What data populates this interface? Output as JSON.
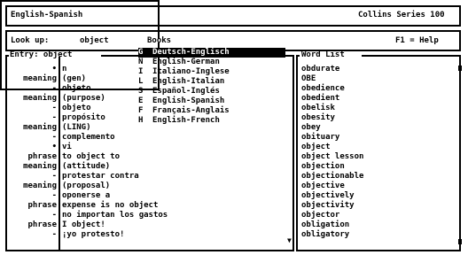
{
  "title": {
    "left": "English-Spanish",
    "right": "Collins Series 100"
  },
  "lookup": {
    "label": "Look up:",
    "value": "object",
    "help": "F1 = Help"
  },
  "entry": {
    "label": "Entry: object",
    "rows": [
      {
        "label": "•",
        "text": "n"
      },
      {
        "label": "meaning",
        "text": "(gen)"
      },
      {
        "label": "-",
        "text": "objeto"
      },
      {
        "label": "meaning",
        "text": "(purpose)"
      },
      {
        "label": "-",
        "text": "objeto"
      },
      {
        "label": "-",
        "text": "propósito"
      },
      {
        "label": "meaning",
        "text": "(LING)"
      },
      {
        "label": "-",
        "text": "complemento"
      },
      {
        "label": "•",
        "text": "vi"
      },
      {
        "label": "phrase",
        "text": "to object to"
      },
      {
        "label": "meaning",
        "text": "(attitude)"
      },
      {
        "label": "-",
        "text": "protestar contra"
      },
      {
        "label": "meaning",
        "text": "(proposal)"
      },
      {
        "label": "-",
        "text": "oponerse a"
      },
      {
        "label": "phrase",
        "text": "expense is no object"
      },
      {
        "label": "-",
        "text": "no importan los gastos"
      },
      {
        "label": "phrase",
        "text": "I object!"
      },
      {
        "label": "-",
        "text": "¡yo protesto!"
      }
    ]
  },
  "wordlist": {
    "label": "Word List",
    "items": [
      "obdurate",
      "OBE",
      "obedience",
      "obedient",
      "obelisk",
      "obesity",
      "obey",
      "obituary",
      "object",
      "object lesson",
      "objection",
      "objectionable",
      "objective",
      "objectively",
      "objectivity",
      "objector",
      "obligation",
      "obligatory"
    ]
  },
  "books": {
    "title": "Books",
    "items": [
      {
        "key": "G",
        "name": "Deutsch-Englisch",
        "selected": true
      },
      {
        "key": "N",
        "name": "English-German",
        "selected": false
      },
      {
        "key": "I",
        "name": "Italiano-Inglese",
        "selected": false
      },
      {
        "key": "L",
        "name": "English-Italian",
        "selected": false
      },
      {
        "key": "S",
        "name": "Español-Inglés",
        "selected": false
      },
      {
        "key": "E",
        "name": "English-Spanish",
        "selected": false
      },
      {
        "key": "F",
        "name": "Français-Anglais",
        "selected": false
      },
      {
        "key": "H",
        "name": "English-French",
        "selected": false
      }
    ]
  }
}
